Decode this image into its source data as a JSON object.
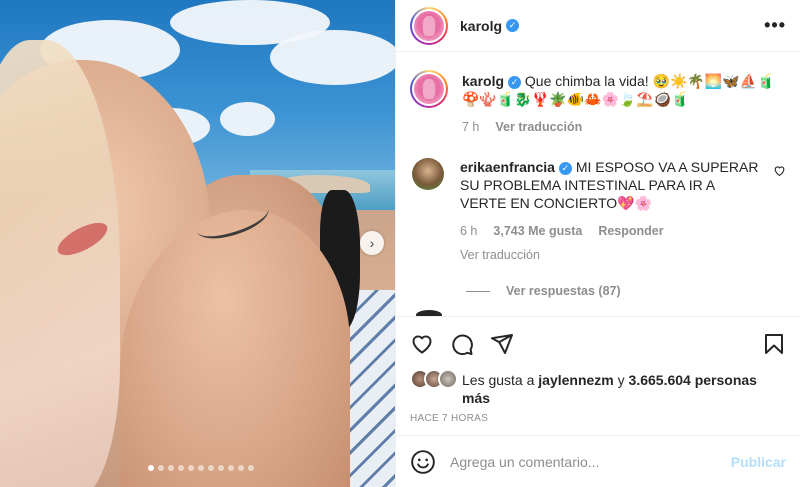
{
  "post": {
    "username": "karolg",
    "more_icon": "more-horizontal-icon",
    "carousel": {
      "slide_count": 11,
      "active_index": 0,
      "next_icon": "chevron-right-icon"
    }
  },
  "caption": {
    "username": "karolg",
    "text": "Que chimba la vida! 🥹☀️🌴🌅🦋⛵🧃🍄🪸🧃🐉🦞🪴🐠🦀🌸🍃⛱️🥥🧃",
    "time": "7 h",
    "translate": "Ver traducción"
  },
  "comment": {
    "username": "erikaenfrancia",
    "text": "MI ESPOSO VA A SUPERAR SU PROBLEMA INTESTINAL PARA IR A VERTE EN CONCIERTO💖🌸",
    "time": "6 h",
    "likes": "3,743 Me gusta",
    "reply": "Responder",
    "translate": "Ver traducción",
    "view_replies": "Ver respuestas (87)",
    "like_icon": "heart-outline-icon"
  },
  "actions": {
    "like_icon": "heart-icon",
    "comment_icon": "comment-bubble-icon",
    "share_icon": "paper-plane-icon",
    "save_icon": "bookmark-icon"
  },
  "likes": {
    "prefix": "Les gusta a ",
    "user": "jaylennezm",
    "middle": " y ",
    "count": "3.665.604 personas más"
  },
  "time_ago": "HACE 7 HORAS",
  "add_comment": {
    "placeholder": "Agrega un comentario...",
    "publish": "Publicar",
    "emoji_icon": "smiley-icon"
  },
  "colors": {
    "verified": "#3897f0",
    "publish_disabled": "#b2dffc",
    "meta": "#8e8e8e"
  }
}
